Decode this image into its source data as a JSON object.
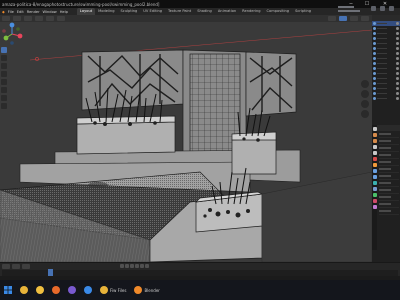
{
  "window": {
    "title": "amaza-politica-8/enagaphotostructure/swimming-pool/swimming_pool2.blend]",
    "minimize_glyph": "─",
    "maximize_glyph": "☐",
    "close_glyph": "✕"
  },
  "menu": {
    "items": [
      "File",
      "Edit",
      "Render",
      "Window",
      "Help"
    ]
  },
  "workspaces": {
    "tabs": [
      "Layout",
      "Modeling",
      "Sculpting",
      "UV Editing",
      "Texture Paint",
      "Shading",
      "Animation",
      "Rendering",
      "Compositing",
      "Scripting"
    ],
    "active": "Layout"
  },
  "viewport": {
    "background": "#3a3a3a",
    "shading": "wireframe",
    "gizmo_axes": [
      "X",
      "Y",
      "Z"
    ],
    "axis_colors": {
      "x": "#e8455c",
      "y": "#7fbf3f",
      "z": "#4a8fe0"
    },
    "origin_marker": "red-circle"
  },
  "outliner": {
    "visible_rows": 16,
    "selected_row": 0,
    "accent": "#334d80"
  },
  "properties": {
    "icons": [
      "tool-icon",
      "render-icon",
      "output-icon",
      "view-layer-icon",
      "scene-icon",
      "world-icon",
      "object-icon",
      "modifier-icon",
      "particles-icon",
      "physics-icon",
      "constraints-icon",
      "data-icon",
      "material-icon",
      "texture-icon"
    ],
    "icon_colors": [
      "#c8c8c8",
      "#d68a4a",
      "#d68a4a",
      "#c8c8c8",
      "#c8c8c8",
      "#d64a4a",
      "#f09a3a",
      "#6aa0e0",
      "#6aa0e0",
      "#3ab0b0",
      "#7a9ad0",
      "#4ac06a",
      "#d04a6a",
      "#c07ad0"
    ]
  },
  "timeline": {
    "controls": [
      "jump-start-icon",
      "prev-key-icon",
      "play-reverse-icon",
      "play-icon",
      "next-key-icon",
      "jump-end-icon"
    ]
  },
  "taskbar": {
    "items": [
      {
        "icon": "chrome-icon",
        "label": "",
        "color": "#e8b43a"
      },
      {
        "icon": "file-explorer-icon",
        "label": "",
        "color": "#f0c040"
      },
      {
        "icon": "firefox-icon",
        "label": "",
        "color": "#e86a2a"
      },
      {
        "icon": "app-icon",
        "label": "",
        "color": "#7a5ad0"
      },
      {
        "icon": "zoom-icon",
        "label": "",
        "color": "#3a8ae8"
      },
      {
        "icon": "files-icon",
        "label": "Fiw Files",
        "color": "#e8b43a"
      },
      {
        "icon": "blender-icon",
        "label": "Blender",
        "color": "#f08a2a"
      }
    ]
  }
}
